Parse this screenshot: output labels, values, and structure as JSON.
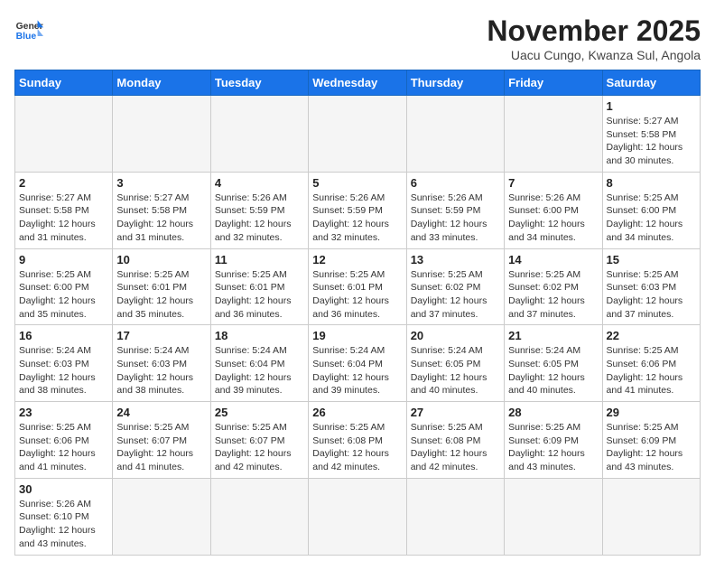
{
  "header": {
    "logo_line1": "General",
    "logo_line2": "Blue",
    "title": "November 2025",
    "subtitle": "Uacu Cungo, Kwanza Sul, Angola"
  },
  "weekdays": [
    "Sunday",
    "Monday",
    "Tuesday",
    "Wednesday",
    "Thursday",
    "Friday",
    "Saturday"
  ],
  "weeks": [
    [
      {
        "day": "",
        "info": ""
      },
      {
        "day": "",
        "info": ""
      },
      {
        "day": "",
        "info": ""
      },
      {
        "day": "",
        "info": ""
      },
      {
        "day": "",
        "info": ""
      },
      {
        "day": "",
        "info": ""
      },
      {
        "day": "1",
        "info": "Sunrise: 5:27 AM\nSunset: 5:58 PM\nDaylight: 12 hours\nand 30 minutes."
      }
    ],
    [
      {
        "day": "2",
        "info": "Sunrise: 5:27 AM\nSunset: 5:58 PM\nDaylight: 12 hours\nand 31 minutes."
      },
      {
        "day": "3",
        "info": "Sunrise: 5:27 AM\nSunset: 5:58 PM\nDaylight: 12 hours\nand 31 minutes."
      },
      {
        "day": "4",
        "info": "Sunrise: 5:26 AM\nSunset: 5:59 PM\nDaylight: 12 hours\nand 32 minutes."
      },
      {
        "day": "5",
        "info": "Sunrise: 5:26 AM\nSunset: 5:59 PM\nDaylight: 12 hours\nand 32 minutes."
      },
      {
        "day": "6",
        "info": "Sunrise: 5:26 AM\nSunset: 5:59 PM\nDaylight: 12 hours\nand 33 minutes."
      },
      {
        "day": "7",
        "info": "Sunrise: 5:26 AM\nSunset: 6:00 PM\nDaylight: 12 hours\nand 34 minutes."
      },
      {
        "day": "8",
        "info": "Sunrise: 5:25 AM\nSunset: 6:00 PM\nDaylight: 12 hours\nand 34 minutes."
      }
    ],
    [
      {
        "day": "9",
        "info": "Sunrise: 5:25 AM\nSunset: 6:00 PM\nDaylight: 12 hours\nand 35 minutes."
      },
      {
        "day": "10",
        "info": "Sunrise: 5:25 AM\nSunset: 6:01 PM\nDaylight: 12 hours\nand 35 minutes."
      },
      {
        "day": "11",
        "info": "Sunrise: 5:25 AM\nSunset: 6:01 PM\nDaylight: 12 hours\nand 36 minutes."
      },
      {
        "day": "12",
        "info": "Sunrise: 5:25 AM\nSunset: 6:01 PM\nDaylight: 12 hours\nand 36 minutes."
      },
      {
        "day": "13",
        "info": "Sunrise: 5:25 AM\nSunset: 6:02 PM\nDaylight: 12 hours\nand 37 minutes."
      },
      {
        "day": "14",
        "info": "Sunrise: 5:25 AM\nSunset: 6:02 PM\nDaylight: 12 hours\nand 37 minutes."
      },
      {
        "day": "15",
        "info": "Sunrise: 5:25 AM\nSunset: 6:03 PM\nDaylight: 12 hours\nand 37 minutes."
      }
    ],
    [
      {
        "day": "16",
        "info": "Sunrise: 5:24 AM\nSunset: 6:03 PM\nDaylight: 12 hours\nand 38 minutes."
      },
      {
        "day": "17",
        "info": "Sunrise: 5:24 AM\nSunset: 6:03 PM\nDaylight: 12 hours\nand 38 minutes."
      },
      {
        "day": "18",
        "info": "Sunrise: 5:24 AM\nSunset: 6:04 PM\nDaylight: 12 hours\nand 39 minutes."
      },
      {
        "day": "19",
        "info": "Sunrise: 5:24 AM\nSunset: 6:04 PM\nDaylight: 12 hours\nand 39 minutes."
      },
      {
        "day": "20",
        "info": "Sunrise: 5:24 AM\nSunset: 6:05 PM\nDaylight: 12 hours\nand 40 minutes."
      },
      {
        "day": "21",
        "info": "Sunrise: 5:24 AM\nSunset: 6:05 PM\nDaylight: 12 hours\nand 40 minutes."
      },
      {
        "day": "22",
        "info": "Sunrise: 5:25 AM\nSunset: 6:06 PM\nDaylight: 12 hours\nand 41 minutes."
      }
    ],
    [
      {
        "day": "23",
        "info": "Sunrise: 5:25 AM\nSunset: 6:06 PM\nDaylight: 12 hours\nand 41 minutes."
      },
      {
        "day": "24",
        "info": "Sunrise: 5:25 AM\nSunset: 6:07 PM\nDaylight: 12 hours\nand 41 minutes."
      },
      {
        "day": "25",
        "info": "Sunrise: 5:25 AM\nSunset: 6:07 PM\nDaylight: 12 hours\nand 42 minutes."
      },
      {
        "day": "26",
        "info": "Sunrise: 5:25 AM\nSunset: 6:08 PM\nDaylight: 12 hours\nand 42 minutes."
      },
      {
        "day": "27",
        "info": "Sunrise: 5:25 AM\nSunset: 6:08 PM\nDaylight: 12 hours\nand 42 minutes."
      },
      {
        "day": "28",
        "info": "Sunrise: 5:25 AM\nSunset: 6:09 PM\nDaylight: 12 hours\nand 43 minutes."
      },
      {
        "day": "29",
        "info": "Sunrise: 5:25 AM\nSunset: 6:09 PM\nDaylight: 12 hours\nand 43 minutes."
      }
    ],
    [
      {
        "day": "30",
        "info": "Sunrise: 5:26 AM\nSunset: 6:10 PM\nDaylight: 12 hours\nand 43 minutes."
      },
      {
        "day": "",
        "info": ""
      },
      {
        "day": "",
        "info": ""
      },
      {
        "day": "",
        "info": ""
      },
      {
        "day": "",
        "info": ""
      },
      {
        "day": "",
        "info": ""
      },
      {
        "day": "",
        "info": ""
      }
    ]
  ]
}
